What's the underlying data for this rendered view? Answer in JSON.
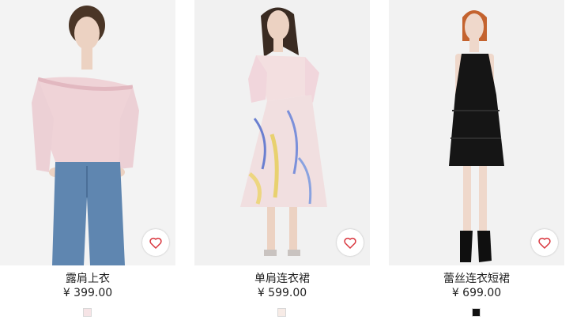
{
  "products": [
    {
      "name": "露肩上衣",
      "price": "¥ 399.00",
      "swatch_color": "#f6e4e6",
      "photo_bg": "#f1f1f1",
      "garment_color": "#efd3d7"
    },
    {
      "name": "单肩连衣裙",
      "price": "¥ 599.00",
      "swatch_color": "#f7ebe6",
      "photo_bg": "#efefef",
      "garment_color": "#f3dfe0"
    },
    {
      "name": "蕾丝连衣短裙",
      "price": "¥ 699.00",
      "swatch_color": "#111111",
      "photo_bg": "#f2f2f2",
      "garment_color": "#151515"
    }
  ],
  "icons": {
    "favorite": "heart-icon"
  },
  "colors": {
    "heart": "#d9363e",
    "text": "#222222"
  }
}
